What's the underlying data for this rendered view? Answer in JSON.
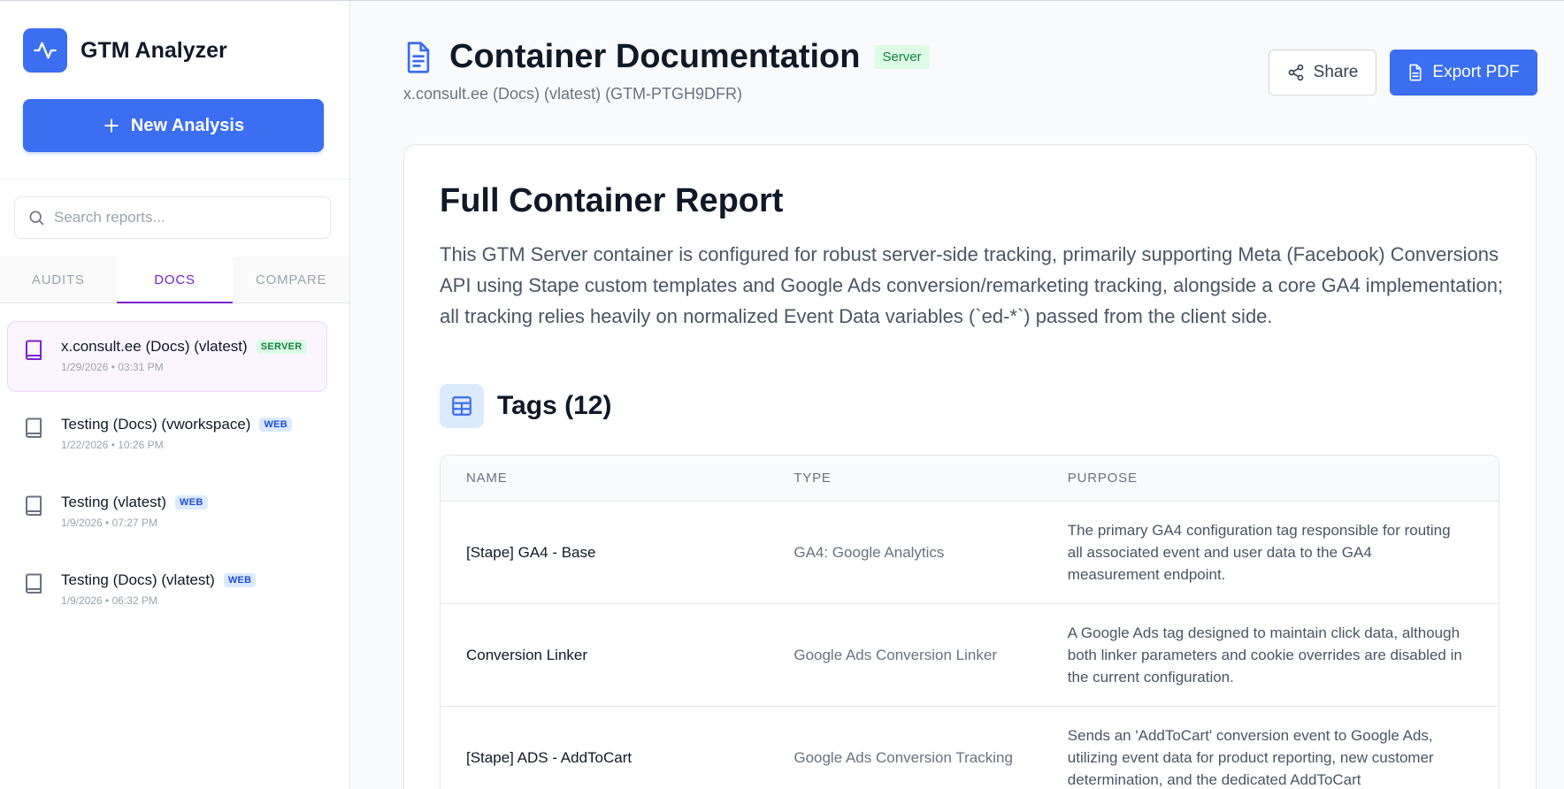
{
  "sidebar": {
    "app_title": "GTM Analyzer",
    "new_button_label": "New Analysis",
    "search_placeholder": "Search reports...",
    "tabs": [
      {
        "label": "AUDITS",
        "active": false
      },
      {
        "label": "DOCS",
        "active": true
      },
      {
        "label": "COMPARE",
        "active": false
      }
    ],
    "reports": [
      {
        "title": "x.consult.ee (Docs) (vlatest)",
        "badge": "SERVER",
        "date": "1/29/2026 • 03:31 PM",
        "active": true
      },
      {
        "title": "Testing (Docs) (vworkspace)",
        "badge": "WEB",
        "date": "1/22/2026 • 10:26 PM",
        "active": false
      },
      {
        "title": "Testing (vlatest)",
        "badge": "WEB",
        "date": "1/9/2026 • 07:27 PM",
        "active": false
      },
      {
        "title": "Testing (Docs) (vlatest)",
        "badge": "WEB",
        "date": "1/9/2026 • 06:32 PM",
        "active": false
      }
    ]
  },
  "header": {
    "title": "Container Documentation",
    "type_badge": "Server",
    "subtitle": "x.consult.ee (Docs) (vlatest) (GTM-PTGH9DFR)",
    "share_label": "Share",
    "export_label": "Export PDF"
  },
  "report": {
    "heading": "Full Container Report",
    "summary": "This GTM Server container is configured for robust server-side tracking, primarily supporting Meta (Facebook) Conversions API using Stape custom templates and Google Ads conversion/remarketing tracking, alongside a core GA4 implementation; all tracking relies heavily on normalized Event Data variables (`ed-*`) passed from the client side."
  },
  "tags": {
    "title": "Tags (12)",
    "columns": [
      "NAME",
      "TYPE",
      "PURPOSE"
    ],
    "rows": [
      {
        "name": "[Stape] GA4 - Base",
        "type": "GA4: Google Analytics",
        "purpose": "The primary GA4 configuration tag responsible for routing all associated event and user data to the GA4 measurement endpoint."
      },
      {
        "name": "Conversion Linker",
        "type": "Google Ads Conversion Linker",
        "purpose": "A Google Ads tag designed to maintain click data, although both linker parameters and cookie overrides are disabled in the current configuration."
      },
      {
        "name": "[Stape] ADS - AddToCart",
        "type": "Google Ads Conversion Tracking",
        "purpose": "Sends an 'AddToCart' conversion event to Google Ads, utilizing event data for product reporting, new customer determination, and the dedicated AddToCart"
      }
    ]
  },
  "colors": {
    "accent": "#3b6ef0",
    "docs_purple": "#7e22ce",
    "server_green": "#15803d",
    "web_blue": "#1d4ed8"
  }
}
